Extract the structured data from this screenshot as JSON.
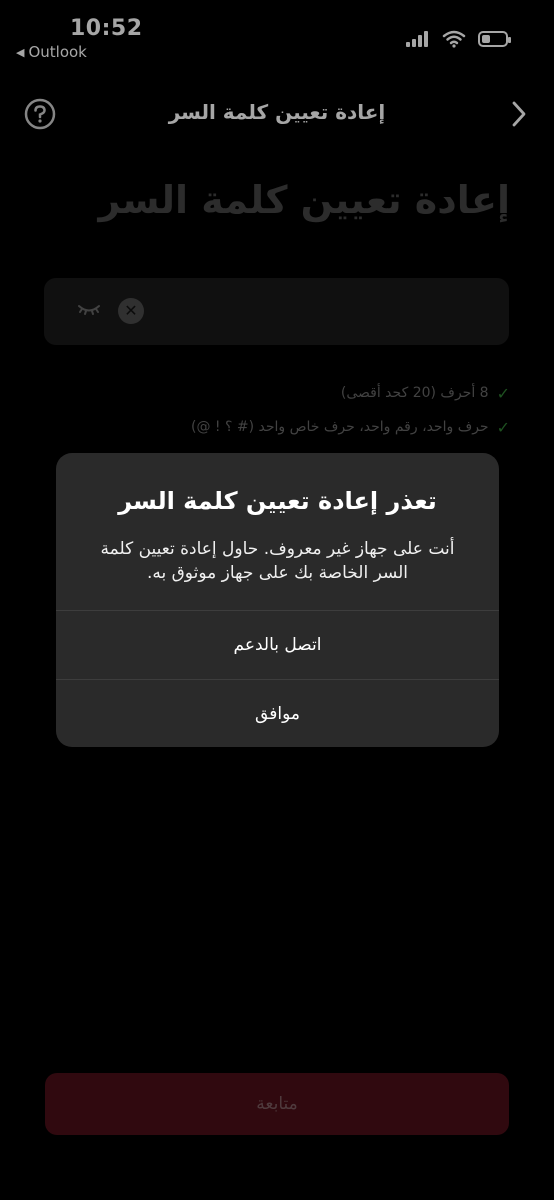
{
  "status_bar": {
    "time": "10:52",
    "back_app": "Outlook",
    "icons": [
      "signal-icon",
      "wifi-icon",
      "battery-icon"
    ]
  },
  "nav": {
    "title": "إعادة تعيين كلمة السر",
    "help_icon": "help-icon",
    "forward_icon": "chevron-right-icon"
  },
  "page": {
    "title": "إعادة تعيين كلمة السر",
    "password": {
      "value": "",
      "icons": [
        "eye-icon",
        "clear-icon"
      ]
    },
    "rules": [
      "8 أحرف (20 كحد أقصى)",
      "حرف واحد، رقم واحد، حرف خاص واحد (# ؟ ! @)"
    ]
  },
  "alert": {
    "title": "تعذر إعادة تعيين كلمة السر",
    "message": "أنت على جهاز غير معروف. حاول إعادة تعيين كلمة السر الخاصة بك على جهاز موثوق به.",
    "buttons": {
      "support": "اتصل بالدعم",
      "ok": "موافق"
    }
  },
  "continue_button": "متابعة",
  "colors": {
    "background": "#000000",
    "alert_bg": "#2a2a2a",
    "field_bg": "#1a1a1a",
    "continue_bg": "#4a0f18",
    "check": "#2e7d32"
  }
}
